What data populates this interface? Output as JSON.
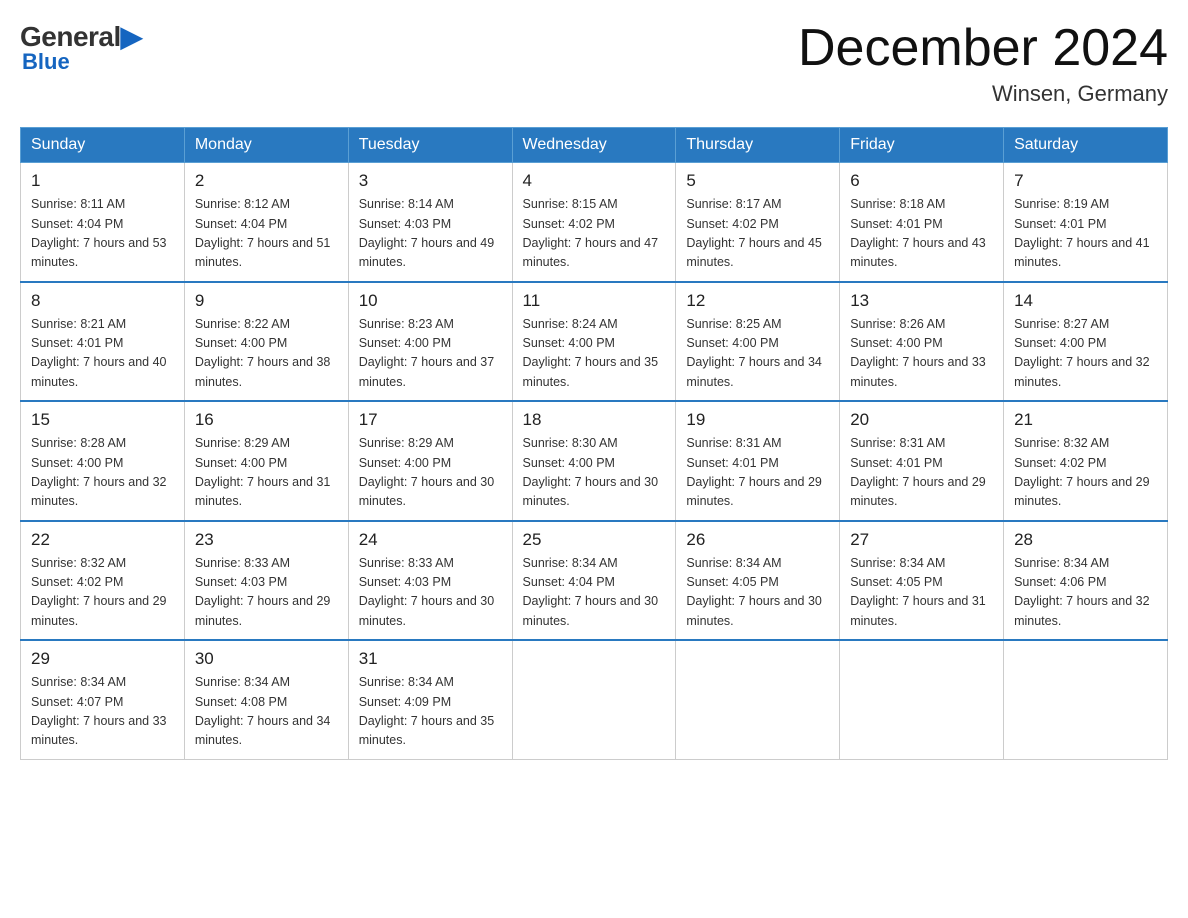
{
  "logo": {
    "general": "General",
    "blue": "Blue"
  },
  "title": "December 2024",
  "subtitle": "Winsen, Germany",
  "days_of_week": [
    "Sunday",
    "Monday",
    "Tuesday",
    "Wednesday",
    "Thursday",
    "Friday",
    "Saturday"
  ],
  "weeks": [
    [
      {
        "day": "1",
        "sunrise": "8:11 AM",
        "sunset": "4:04 PM",
        "daylight": "7 hours and 53 minutes."
      },
      {
        "day": "2",
        "sunrise": "8:12 AM",
        "sunset": "4:04 PM",
        "daylight": "7 hours and 51 minutes."
      },
      {
        "day": "3",
        "sunrise": "8:14 AM",
        "sunset": "4:03 PM",
        "daylight": "7 hours and 49 minutes."
      },
      {
        "day": "4",
        "sunrise": "8:15 AM",
        "sunset": "4:02 PM",
        "daylight": "7 hours and 47 minutes."
      },
      {
        "day": "5",
        "sunrise": "8:17 AM",
        "sunset": "4:02 PM",
        "daylight": "7 hours and 45 minutes."
      },
      {
        "day": "6",
        "sunrise": "8:18 AM",
        "sunset": "4:01 PM",
        "daylight": "7 hours and 43 minutes."
      },
      {
        "day": "7",
        "sunrise": "8:19 AM",
        "sunset": "4:01 PM",
        "daylight": "7 hours and 41 minutes."
      }
    ],
    [
      {
        "day": "8",
        "sunrise": "8:21 AM",
        "sunset": "4:01 PM",
        "daylight": "7 hours and 40 minutes."
      },
      {
        "day": "9",
        "sunrise": "8:22 AM",
        "sunset": "4:00 PM",
        "daylight": "7 hours and 38 minutes."
      },
      {
        "day": "10",
        "sunrise": "8:23 AM",
        "sunset": "4:00 PM",
        "daylight": "7 hours and 37 minutes."
      },
      {
        "day": "11",
        "sunrise": "8:24 AM",
        "sunset": "4:00 PM",
        "daylight": "7 hours and 35 minutes."
      },
      {
        "day": "12",
        "sunrise": "8:25 AM",
        "sunset": "4:00 PM",
        "daylight": "7 hours and 34 minutes."
      },
      {
        "day": "13",
        "sunrise": "8:26 AM",
        "sunset": "4:00 PM",
        "daylight": "7 hours and 33 minutes."
      },
      {
        "day": "14",
        "sunrise": "8:27 AM",
        "sunset": "4:00 PM",
        "daylight": "7 hours and 32 minutes."
      }
    ],
    [
      {
        "day": "15",
        "sunrise": "8:28 AM",
        "sunset": "4:00 PM",
        "daylight": "7 hours and 32 minutes."
      },
      {
        "day": "16",
        "sunrise": "8:29 AM",
        "sunset": "4:00 PM",
        "daylight": "7 hours and 31 minutes."
      },
      {
        "day": "17",
        "sunrise": "8:29 AM",
        "sunset": "4:00 PM",
        "daylight": "7 hours and 30 minutes."
      },
      {
        "day": "18",
        "sunrise": "8:30 AM",
        "sunset": "4:00 PM",
        "daylight": "7 hours and 30 minutes."
      },
      {
        "day": "19",
        "sunrise": "8:31 AM",
        "sunset": "4:01 PM",
        "daylight": "7 hours and 29 minutes."
      },
      {
        "day": "20",
        "sunrise": "8:31 AM",
        "sunset": "4:01 PM",
        "daylight": "7 hours and 29 minutes."
      },
      {
        "day": "21",
        "sunrise": "8:32 AM",
        "sunset": "4:02 PM",
        "daylight": "7 hours and 29 minutes."
      }
    ],
    [
      {
        "day": "22",
        "sunrise": "8:32 AM",
        "sunset": "4:02 PM",
        "daylight": "7 hours and 29 minutes."
      },
      {
        "day": "23",
        "sunrise": "8:33 AM",
        "sunset": "4:03 PM",
        "daylight": "7 hours and 29 minutes."
      },
      {
        "day": "24",
        "sunrise": "8:33 AM",
        "sunset": "4:03 PM",
        "daylight": "7 hours and 30 minutes."
      },
      {
        "day": "25",
        "sunrise": "8:34 AM",
        "sunset": "4:04 PM",
        "daylight": "7 hours and 30 minutes."
      },
      {
        "day": "26",
        "sunrise": "8:34 AM",
        "sunset": "4:05 PM",
        "daylight": "7 hours and 30 minutes."
      },
      {
        "day": "27",
        "sunrise": "8:34 AM",
        "sunset": "4:05 PM",
        "daylight": "7 hours and 31 minutes."
      },
      {
        "day": "28",
        "sunrise": "8:34 AM",
        "sunset": "4:06 PM",
        "daylight": "7 hours and 32 minutes."
      }
    ],
    [
      {
        "day": "29",
        "sunrise": "8:34 AM",
        "sunset": "4:07 PM",
        "daylight": "7 hours and 33 minutes."
      },
      {
        "day": "30",
        "sunrise": "8:34 AM",
        "sunset": "4:08 PM",
        "daylight": "7 hours and 34 minutes."
      },
      {
        "day": "31",
        "sunrise": "8:34 AM",
        "sunset": "4:09 PM",
        "daylight": "7 hours and 35 minutes."
      },
      null,
      null,
      null,
      null
    ]
  ]
}
